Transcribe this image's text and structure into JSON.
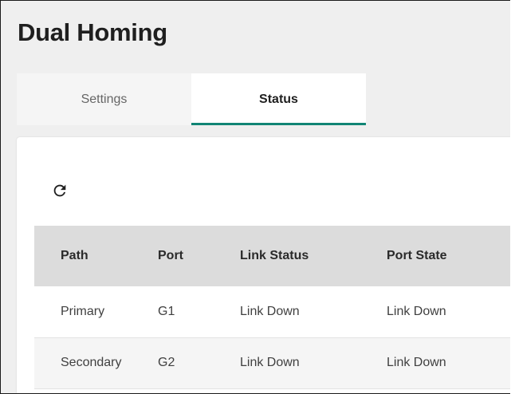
{
  "page": {
    "title": "Dual Homing"
  },
  "tabs": [
    {
      "label": "Settings",
      "active": false
    },
    {
      "label": "Status",
      "active": true
    }
  ],
  "toolbar": {
    "refresh_icon": "refresh-icon"
  },
  "colors": {
    "accent": "#118575",
    "header_bg": "#dcdcdc",
    "page_bg": "#efefef"
  },
  "table": {
    "columns": [
      "Path",
      "Port",
      "Link Status",
      "Port State"
    ],
    "rows": [
      {
        "path": "Primary",
        "port": "G1",
        "link_status": "Link Down",
        "port_state": "Link Down"
      },
      {
        "path": "Secondary",
        "port": "G2",
        "link_status": "Link Down",
        "port_state": "Link Down"
      }
    ]
  }
}
